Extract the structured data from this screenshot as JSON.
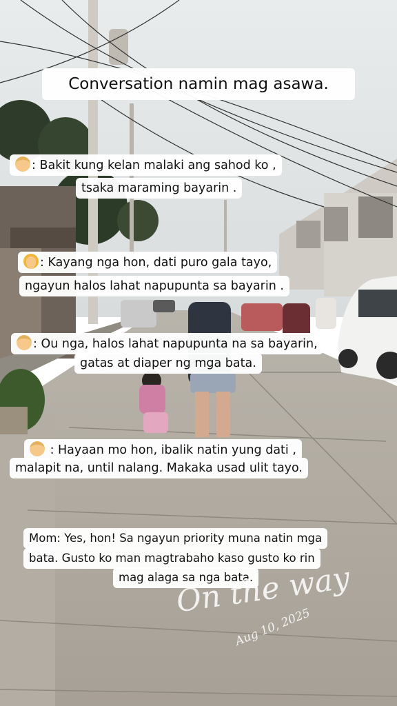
{
  "story": {
    "title": "Conversation namin mag asawa.",
    "messages": [
      {
        "speaker_icon": "man-emoji",
        "line1": ": Bakit kung kelan malaki ang sahod ko ,",
        "line2": "tsaka maraming bayarin ."
      },
      {
        "speaker_icon": "woman-emoji",
        "line1": ": Kayang nga hon, dati puro gala tayo,",
        "line2": "ngayun halos lahat napupunta sa bayarin ."
      },
      {
        "speaker_icon": "man-emoji",
        "line1": ": Ou nga, halos lahat napupunta na sa bayarin,",
        "line2": "gatas at diaper ng mga bata."
      },
      {
        "speaker_icon": "man-emoji",
        "line1": " : Hayaan mo hon, ibalik natin yung dati ,",
        "line2": "malapit na, until nalang. Makaka usad ulit tayo."
      },
      {
        "speaker": "Mom",
        "line1": "Mom: Yes, hon! Sa ngayun priority muna natin mga",
        "line2": "bata. Gusto ko man magtrabaho kaso gusto ko rin",
        "line3": "mag alaga sa nga bata."
      }
    ],
    "watermark_script": "On the way",
    "watermark_date": "Aug 10, 2025"
  }
}
